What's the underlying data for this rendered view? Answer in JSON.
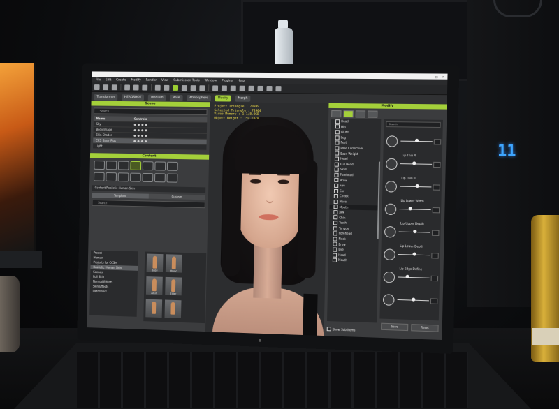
{
  "menu": [
    "File",
    "Edit",
    "Create",
    "Modify",
    "Render",
    "View",
    "Submission Tools",
    "Window",
    "Plugins",
    "Help"
  ],
  "toolbar2": {
    "transformer": "Transformer",
    "headshot_tool": "HEADSHOT",
    "medium_select": "Medium",
    "pose": "Pose",
    "atmosphere": "Atmosphere",
    "modify": "Modify",
    "morph": "Morph"
  },
  "hud": {
    "project_triangle": "Project Triangle : 78939",
    "selected_triangle": "Selected Triangle : 74904",
    "video_memory": "Video Memory : 1.1/8.0GB",
    "object_height": "Object Height : 159.63cm"
  },
  "scene_panel": {
    "title": "Scene",
    "search_placeholder": "Search",
    "col_name": "Name",
    "col_controls": "Controls",
    "rows": [
      {
        "name": "Sky"
      },
      {
        "name": "Body Image"
      },
      {
        "name": "Skin Shader"
      },
      {
        "name": "CC3_Base_Plus"
      },
      {
        "name": "Light"
      }
    ]
  },
  "content_panel": {
    "title": "Content",
    "path": "Content Realistic Human Skin",
    "tab_template": "Template",
    "tab_custom": "Custom",
    "search_placeholder": "Search",
    "tree": [
      "Preset",
      "Human",
      "Projects for CC3+",
      "Realistic Human Skin",
      "Scenes",
      "Full Skin",
      "Normal Effects",
      "Skin Effects",
      "Deformers"
    ],
    "thumbs": [
      "Baby",
      "Young",
      "Adult",
      "Elder",
      "",
      ""
    ]
  },
  "modify_panel": {
    "title": "Modify",
    "morph_tree": [
      {
        "label": "Head"
      },
      {
        "label": "Hip"
      },
      {
        "label": "Glute"
      },
      {
        "label": "Leg"
      },
      {
        "label": "Feet"
      },
      {
        "label": "Pose Corrective"
      },
      {
        "label": "Base Weight"
      },
      {
        "label": "Head"
      },
      {
        "label": "Full Head"
      },
      {
        "label": "Skull"
      },
      {
        "label": "Forehead"
      },
      {
        "label": "Brow"
      },
      {
        "label": "Eye"
      },
      {
        "label": "Ear"
      },
      {
        "label": "Cheek"
      },
      {
        "label": "Nose"
      },
      {
        "label": "Mouth",
        "selected": true
      },
      {
        "label": "Jaw"
      },
      {
        "label": "Chin"
      },
      {
        "label": "Teeth"
      },
      {
        "label": "Tongue"
      },
      {
        "label": "Forehead"
      },
      {
        "label": "Neck"
      },
      {
        "label": "Brow"
      },
      {
        "label": "Eye"
      },
      {
        "label": "Head"
      },
      {
        "label": "Mouth"
      }
    ],
    "sliders_search": "Search",
    "sliders": [
      {
        "name": "",
        "value": 0.5
      },
      {
        "name": "Lip Thin A",
        "value": 0.45
      },
      {
        "name": "Lip Thin B",
        "value": 0.55
      },
      {
        "name": "Lip Lower Width",
        "value": 0.35
      },
      {
        "name": "Lip Upper Depth",
        "value": 0.5
      },
      {
        "name": "Lip Lower Depth",
        "value": 0.5
      },
      {
        "name": "Lip Edge Define",
        "value": 0.3
      },
      {
        "name": "",
        "value": 0.5
      }
    ],
    "button_save": "Save",
    "button_reset": "Reset",
    "show_sub_items": "Show Sub Items"
  },
  "colors": {
    "accent_green": "#a4d03a",
    "hud_yellow": "#f6e24a",
    "led_blue": "#3ea6ff"
  },
  "tower_led_text": "11"
}
